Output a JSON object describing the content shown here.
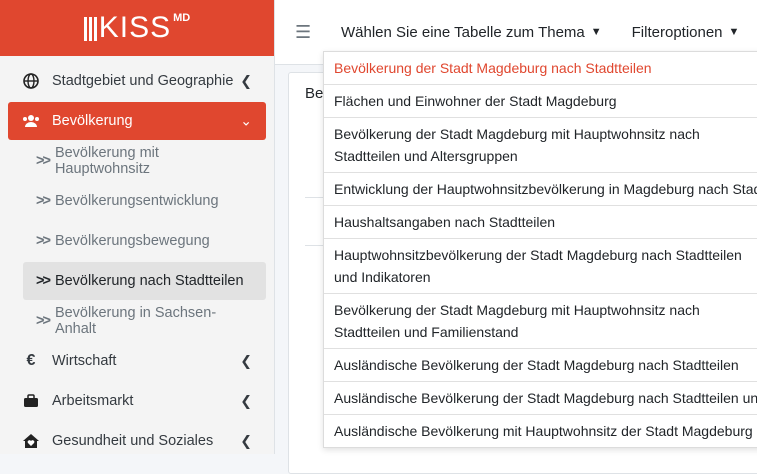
{
  "brand": {
    "logo_text": "KISS",
    "logo_sup": "MD"
  },
  "sidebar": {
    "items": [
      {
        "label": "Stadtgebiet und Geographie",
        "icon": "globe-icon"
      },
      {
        "label": "Bevölkerung",
        "icon": "users-icon"
      },
      {
        "label": "Bevölkerung mit Hauptwohnsitz"
      },
      {
        "label": "Bevölkerungsentwicklung"
      },
      {
        "label": "Bevölkerungsbewegung"
      },
      {
        "label": "Bevölkerung nach Stadtteilen"
      },
      {
        "label": "Bevölkerung in Sachsen-Anhalt"
      },
      {
        "label": "Wirtschaft",
        "icon": "euro-icon"
      },
      {
        "label": "Arbeitsmarkt",
        "icon": "briefcase-icon"
      },
      {
        "label": "Gesundheit und Soziales",
        "icon": "home-heart-icon"
      }
    ]
  },
  "topbar": {
    "table_menu_label": "Wählen Sie eine Tabelle zum Thema",
    "filter_menu_label": "Filteroptionen"
  },
  "content": {
    "card_title_fragment": "Be"
  },
  "dropdown": {
    "items": [
      "Bevölkerung der Stadt Magdeburg nach Stadtteilen",
      "Flächen und Einwohner der Stadt Magdeburg",
      "Bevölkerung der Stadt Magdeburg mit Hauptwohnsitz nach Stadtteilen und Altersgruppen",
      "Entwicklung der Hauptwohnsitzbevölkerung in Magdeburg nach Stadtteilen",
      "Haushaltsangaben nach Stadtteilen",
      "Hauptwohnsitzbevölkerung der Stadt Magdeburg nach Stadtteilen und Indikatoren",
      "Bevölkerung der Stadt Magdeburg mit Hauptwohnsitz nach Stadtteilen und Familienstand",
      "Ausländische Bevölkerung der Stadt Magdeburg nach Stadtteilen",
      "Ausländische Bevölkerung der Stadt Magdeburg nach Stadtteilen und",
      "Ausländische Bevölkerung mit Hauptwohnsitz der Stadt Magdeburg"
    ]
  },
  "colors": {
    "brand": "#e0472f",
    "selected_bg": "#e2e2e2"
  }
}
